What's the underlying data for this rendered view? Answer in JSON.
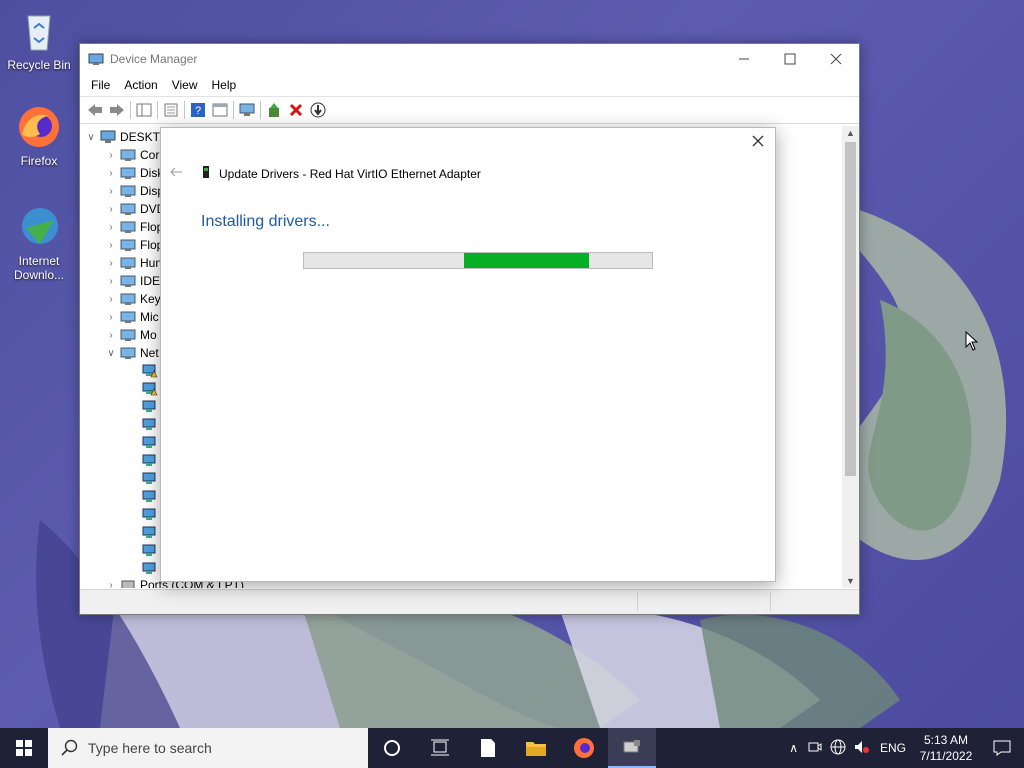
{
  "desktop": {
    "icons": [
      {
        "label": "Recycle Bin",
        "icon": "recycle-bin-icon"
      },
      {
        "label": "Firefox",
        "icon": "firefox-icon"
      },
      {
        "label": "Internet Downlo...",
        "icon": "internet-download-manager-icon"
      }
    ]
  },
  "window": {
    "title": "Device Manager",
    "menu": [
      "File",
      "Action",
      "View",
      "Help"
    ],
    "tree": {
      "root": "DESKTO",
      "items": [
        {
          "label": "Cor",
          "icon": "computer-icon"
        },
        {
          "label": "Disk",
          "icon": "disk-drive-icon"
        },
        {
          "label": "Disp",
          "icon": "display-adapter-icon"
        },
        {
          "label": "DVD",
          "icon": "dvd-drive-icon"
        },
        {
          "label": "Flop",
          "icon": "floppy-controller-icon"
        },
        {
          "label": "Flop",
          "icon": "floppy-drive-icon"
        },
        {
          "label": "Hun",
          "icon": "hid-icon"
        },
        {
          "label": "IDE",
          "icon": "ide-controller-icon"
        },
        {
          "label": "Keyl",
          "icon": "keyboard-icon"
        },
        {
          "label": "Mic",
          "icon": "mouse-icon"
        },
        {
          "label": "Mo",
          "icon": "monitor-icon"
        },
        {
          "label": "Net",
          "icon": "network-adapter-icon"
        }
      ],
      "last_item": "Ports (COM & LPT)"
    }
  },
  "dialog": {
    "header": "Update Drivers - Red Hat VirtIO Ethernet Adapter",
    "status": "Installing drivers...",
    "progress": {
      "start": 0.46,
      "end": 0.82,
      "color": "#06b025"
    }
  },
  "taskbar": {
    "search_placeholder": "Type here to search",
    "language": "ENG",
    "time": "5:13 AM",
    "date": "7/11/2022"
  }
}
